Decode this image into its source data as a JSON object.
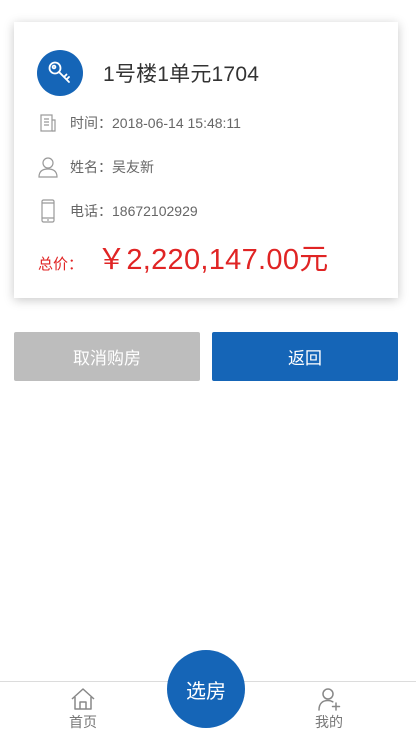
{
  "card": {
    "title": "1号楼1单元1704",
    "icons": {
      "badge": "key-icon",
      "time": "building-icon",
      "name": "person-icon",
      "phone": "mobile-phone-icon"
    },
    "time": {
      "label": "时间：",
      "value": "2018-06-14 15:48:11"
    },
    "name": {
      "label": "姓名：",
      "value": "吴友新"
    },
    "phone": {
      "label": "电话：",
      "value": "18672102929"
    },
    "total": {
      "label": "总价：",
      "value": "￥2,220,147.00元"
    }
  },
  "actions": {
    "cancel_label": "取消购房",
    "back_label": "返回"
  },
  "tabbar": {
    "home_label": "首页",
    "home_icon": "home-icon",
    "center_label": "选房",
    "mine_label": "我的",
    "mine_icon": "user-add-icon"
  },
  "colors": {
    "primary": "#1565b7",
    "price": "#e02424",
    "disabled": "#bdbdbd"
  }
}
